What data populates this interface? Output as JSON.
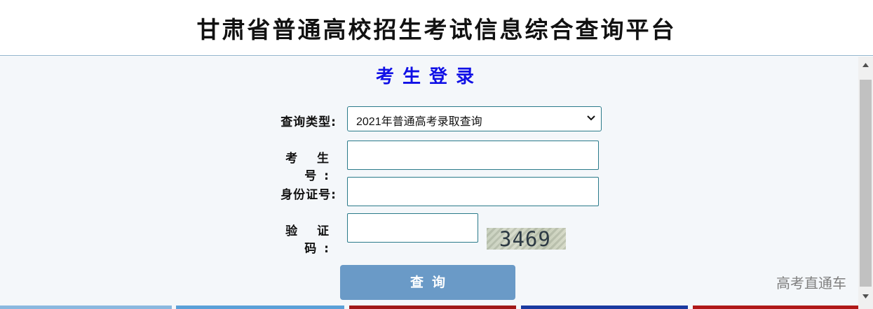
{
  "header": {
    "title": "甘肃省普通高校招生考试信息综合查询平台"
  },
  "login": {
    "title": "考生登录",
    "query_type_label": "查询类型:",
    "query_type_selected": "2021年普通高考录取查询",
    "exam_no_label": "考 生 号:",
    "exam_no_value": "",
    "id_label": "身份证号:",
    "id_value": "",
    "captcha_label": "验 证 码:",
    "captcha_value": "",
    "captcha_image_text": "3469",
    "submit_label": "查询"
  },
  "watermark": "高考直通车",
  "colors": {
    "title_blue": "#1010e6",
    "button": "#6a9ac7",
    "border": "#2a7a8a",
    "background": "#f4f7fa"
  },
  "icons": {
    "select_arrow": "chevron-down-icon",
    "scroll_up": "triangle-up-icon",
    "scroll_down": "triangle-down-icon"
  }
}
